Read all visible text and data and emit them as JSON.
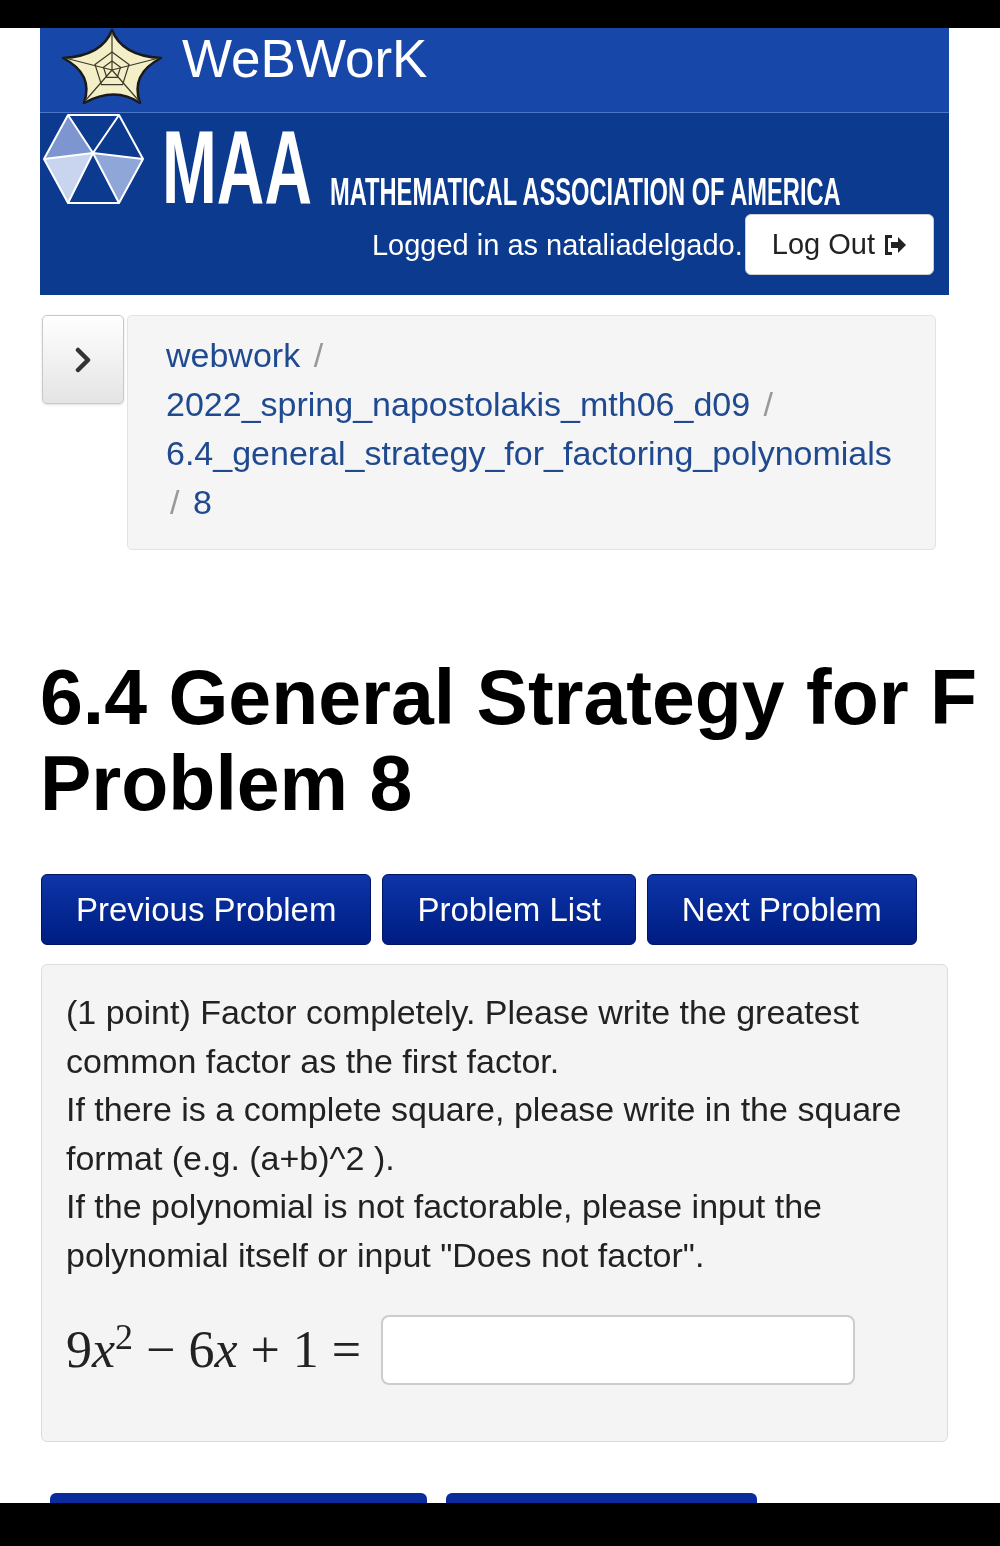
{
  "header": {
    "brand": "WeBWorK",
    "org_short": "MAA",
    "org_name": "MATHEMATICAL ASSOCIATION OF AMERICA",
    "login_text": "Logged in as nataliadelgado.",
    "logout_button": "Log Out"
  },
  "breadcrumb": {
    "separator": "/",
    "items": [
      "webwork",
      "2022_spring_napostolakis_mth06_d09",
      "6.4_general_strategy_for_factoring_polynomials",
      "8"
    ]
  },
  "page_title": {
    "lines": [
      "6.4 General Strategy for F",
      "Problem 8"
    ]
  },
  "nav_buttons": [
    "Previous Problem",
    "Problem List",
    "Next Problem"
  ],
  "problem": {
    "paragraphs": [
      "(1 point) Factor completely. Please write the greatest common factor as the first factor.",
      "If there is a complete square, please write in the square format (e.g. (a+b)^2 ).",
      "If the polynomial is not factorable, please input the polynomial itself or input \"Does not factor\"."
    ],
    "equation": [
      {
        "kind": "number",
        "text": "9"
      },
      {
        "kind": "variable",
        "text": "x"
      },
      {
        "kind": "exponent",
        "text": "2"
      },
      {
        "kind": "operator",
        "text": " − 6"
      },
      {
        "kind": "variable",
        "text": "x"
      },
      {
        "kind": "operator",
        "text": " + 1 ="
      }
    ]
  }
}
